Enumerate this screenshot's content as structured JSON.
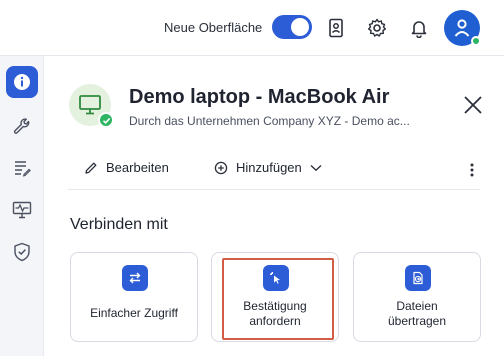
{
  "topbar": {
    "toggle_label": "Neue Oberfläche",
    "toggle_on": true,
    "icons": [
      "contact-card-icon",
      "settings-gear-icon",
      "notification-bell-icon"
    ],
    "avatar_status_color": "#2eb563"
  },
  "sidebar": {
    "items": [
      {
        "icon": "info-icon",
        "active": true
      },
      {
        "icon": "wrench-icon",
        "active": false
      },
      {
        "icon": "notes-icon",
        "active": false
      },
      {
        "icon": "monitor-activity-icon",
        "active": false
      },
      {
        "icon": "shield-check-icon",
        "active": false
      }
    ]
  },
  "device": {
    "title": "Demo laptop - MacBook Air",
    "subtitle": "Durch das Unternehmen Company XYZ - Demo ac..."
  },
  "actions": {
    "edit_label": "Bearbeiten",
    "add_label": "Hinzufügen"
  },
  "connect": {
    "title": "Verbinden mit",
    "cards": [
      {
        "line1": "Einfacher Zugriff",
        "line2": "",
        "icon": "swap-arrows-icon"
      },
      {
        "line1": "Bestätigung",
        "line2": "anfordern",
        "icon": "cursor-click-icon",
        "highlighted": true
      },
      {
        "line1": "Dateien",
        "line2": "übertragen",
        "icon": "file-transfer-icon"
      }
    ]
  },
  "colors": {
    "accent": "#2c5cd6",
    "success": "#2eb563",
    "highlight": "#d25c44"
  }
}
